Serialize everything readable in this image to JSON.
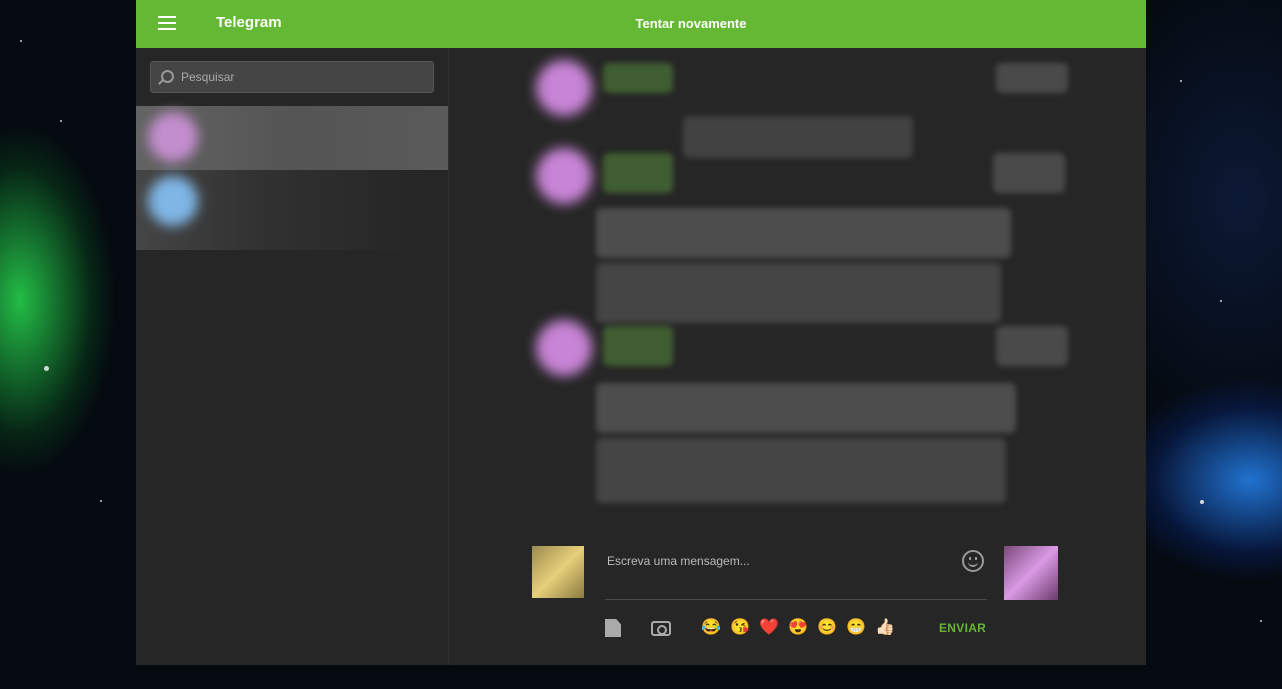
{
  "header": {
    "app_title": "Telegram",
    "status": "Tentar novamente"
  },
  "sidebar": {
    "search_placeholder": "Pesquisar"
  },
  "composer": {
    "placeholder": "Escreva uma mensagem...",
    "send_label": "ENVIAR",
    "quick_emojis": [
      "😂",
      "😘",
      "❤️",
      "😍",
      "😊",
      "😁",
      "👍🏻"
    ]
  },
  "colors": {
    "accent": "#65b833",
    "background": "#262626"
  }
}
